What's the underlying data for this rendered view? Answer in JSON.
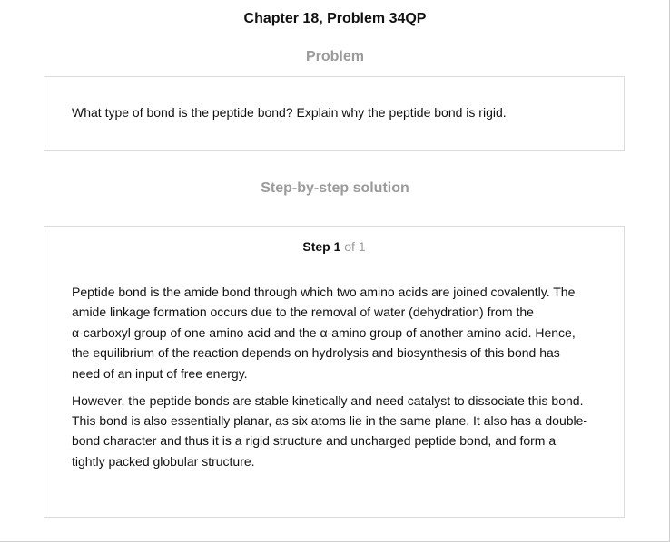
{
  "header": {
    "title": "Chapter 18, Problem 34QP"
  },
  "problem": {
    "heading": "Problem",
    "text": "What type of bond is the peptide bond? Explain why the peptide bond is rigid."
  },
  "solution": {
    "heading": "Step-by-step solution",
    "step_label": "Step 1",
    "step_total": " of 1",
    "paragraphs": [
      {
        "lines": [
          "Peptide bond is the amide bond through which two amino acids are joined covalently. The",
          "amide linkage formation occurs due to the removal of water (dehydration) from the",
          "α-carboxyl group of one amino acid and the α-amino group of another amino acid. Hence,",
          "the equilibrium of the reaction depends on hydrolysis and biosynthesis of this bond has",
          "need of an input of free energy."
        ]
      },
      {
        "lines": [
          "However, the peptide bonds are stable kinetically and need catalyst to dissociate this bond.",
          "This bond is also essentially planar, as six atoms lie in the same plane. It also has a double-",
          "bond character and thus it is a rigid structure and uncharged peptide bond, and form a",
          "tightly packed globular structure."
        ]
      }
    ]
  },
  "colors": {
    "text": "#111111",
    "muted_heading": "#9b9b9b",
    "box_border": "#dcdcdc",
    "background": "#ffffff"
  }
}
